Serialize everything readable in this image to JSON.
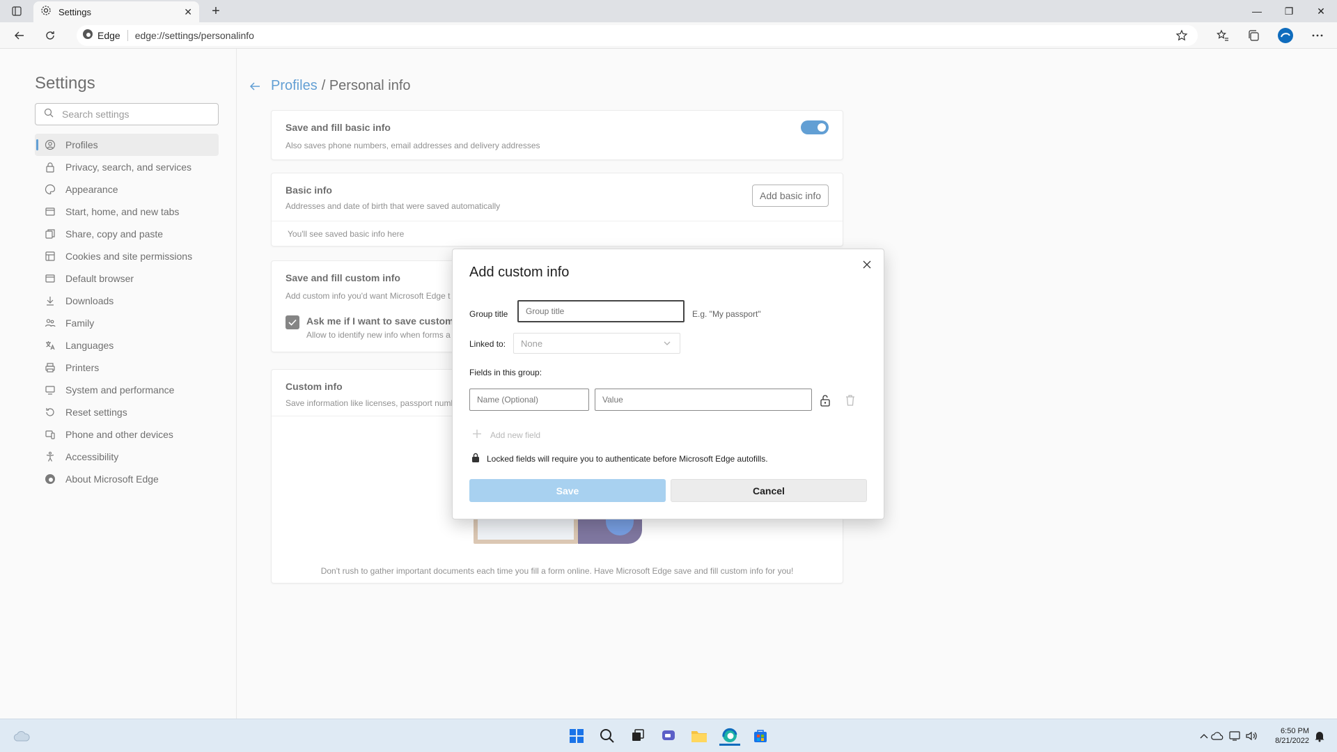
{
  "browser": {
    "tab_title": "Settings",
    "site_label": "Edge",
    "url": "edge://settings/personalinfo"
  },
  "sidebar": {
    "title": "Settings",
    "search_placeholder": "Search settings",
    "items": [
      {
        "label": "Profiles",
        "icon": "profile-icon",
        "active": true
      },
      {
        "label": "Privacy, search, and services",
        "icon": "lock-icon"
      },
      {
        "label": "Appearance",
        "icon": "appearance-icon"
      },
      {
        "label": "Start, home, and new tabs",
        "icon": "home-icon"
      },
      {
        "label": "Share, copy and paste",
        "icon": "share-icon"
      },
      {
        "label": "Cookies and site permissions",
        "icon": "cookies-icon"
      },
      {
        "label": "Default browser",
        "icon": "browser-icon"
      },
      {
        "label": "Downloads",
        "icon": "download-icon"
      },
      {
        "label": "Family",
        "icon": "family-icon"
      },
      {
        "label": "Languages",
        "icon": "languages-icon"
      },
      {
        "label": "Printers",
        "icon": "printer-icon"
      },
      {
        "label": "System and performance",
        "icon": "system-icon"
      },
      {
        "label": "Reset settings",
        "icon": "reset-icon"
      },
      {
        "label": "Phone and other devices",
        "icon": "phone-icon"
      },
      {
        "label": "Accessibility",
        "icon": "accessibility-icon"
      },
      {
        "label": "About Microsoft Edge",
        "icon": "edge-icon"
      }
    ]
  },
  "main": {
    "breadcrumb_link": "Profiles",
    "breadcrumb_current": "/ Personal info",
    "save_fill_basic": {
      "title": "Save and fill basic info",
      "subtitle": "Also saves phone numbers, email addresses and delivery addresses",
      "enabled": true
    },
    "basic_info": {
      "title": "Basic info",
      "subtitle": "Addresses and date of birth that were saved automatically",
      "button": "Add basic info",
      "empty": "You'll see saved basic info here"
    },
    "save_fill_custom": {
      "title": "Save and fill custom info",
      "subtitle": "Add custom info you'd want Microsoft Edge t",
      "checkbox_label": "Ask me if I want to save custom i",
      "checkbox_sub": "Allow to identify new info when forms a",
      "checked": true
    },
    "custom_info": {
      "title": "Custom info",
      "subtitle": "Save information like licenses, passport numb",
      "footer": "Don't rush to gather important documents each time you fill a form online. Have Microsoft Edge save and fill custom info for you!"
    }
  },
  "dialog": {
    "title": "Add custom info",
    "group_title_label": "Group title",
    "group_title_placeholder": "Group title",
    "group_title_hint": "E.g. \"My passport\"",
    "linked_to_label": "Linked to:",
    "linked_to_value": "None",
    "fields_label": "Fields in this group:",
    "name_placeholder": "Name (Optional)",
    "value_placeholder": "Value",
    "add_new_field": "Add new field",
    "lock_note": "Locked fields will require you to authenticate before Microsoft Edge autofills.",
    "save": "Save",
    "cancel": "Cancel"
  },
  "taskbar": {
    "time": "6:50 PM",
    "date": "8/21/2022"
  },
  "colors": {
    "accent": "#0f6cbd",
    "save_disabled": "#a8d1f0"
  }
}
